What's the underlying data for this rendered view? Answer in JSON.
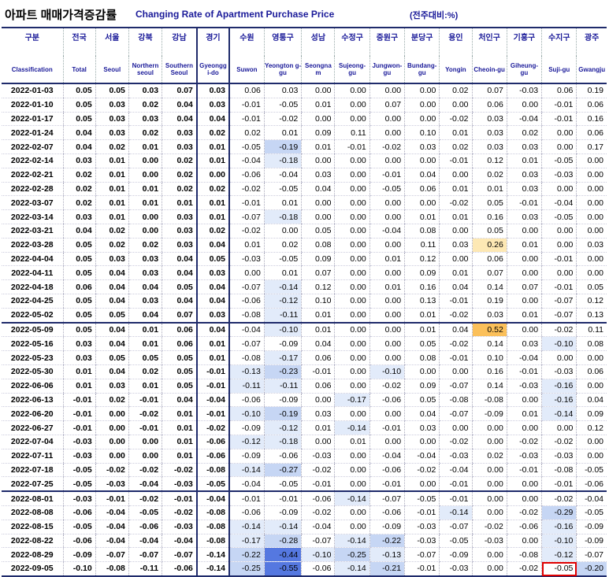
{
  "title": {
    "korean": "아파트 매매가격증감률",
    "english": "Changing Rate of Apartment Purchase Price",
    "unit": "(전주대비:%)"
  },
  "columns": [
    {
      "ko": "구분",
      "en": "Classification"
    },
    {
      "ko": "전국",
      "en": "Total"
    },
    {
      "ko": "서울",
      "en": "Seoul"
    },
    {
      "ko": "강북",
      "en": "Northern seoul"
    },
    {
      "ko": "강남",
      "en": "Southern Seoul"
    },
    {
      "ko": "경기",
      "en": "Gyeongg i-do"
    },
    {
      "ko": "수원",
      "en": "Suwon"
    },
    {
      "ko": "영통구",
      "en": "Yeongton g-gu"
    },
    {
      "ko": "성남",
      "en": "Seongna m"
    },
    {
      "ko": "수정구",
      "en": "Sujeong-gu"
    },
    {
      "ko": "중원구",
      "en": "Jungwon-gu"
    },
    {
      "ko": "분당구",
      "en": "Bundang-gu"
    },
    {
      "ko": "용인",
      "en": "Yongin"
    },
    {
      "ko": "처인구",
      "en": "Cheoin-gu"
    },
    {
      "ko": "기흥구",
      "en": "Giheung-gu"
    },
    {
      "ko": "수지구",
      "en": "Suji-gu"
    },
    {
      "ko": "광주",
      "en": "Gwangju"
    }
  ],
  "rows": [
    {
      "date": "2022-01-03",
      "values": [
        "0.05",
        "0.05",
        "0.03",
        "0.07",
        "0.03",
        "0.06",
        "0.03",
        "0.00",
        "0.00",
        "0.00",
        "0.00",
        "0.02",
        "0.07",
        "-0.03",
        "0.06",
        "0.19"
      ]
    },
    {
      "date": "2022-01-10",
      "values": [
        "0.05",
        "0.03",
        "0.02",
        "0.04",
        "0.03",
        "-0.01",
        "-0.05",
        "0.01",
        "0.00",
        "0.07",
        "0.00",
        "0.00",
        "0.06",
        "0.00",
        "-0.01",
        "0.06"
      ]
    },
    {
      "date": "2022-01-17",
      "values": [
        "0.05",
        "0.03",
        "0.03",
        "0.04",
        "0.04",
        "-0.01",
        "-0.02",
        "0.00",
        "0.00",
        "0.00",
        "0.00",
        "-0.02",
        "0.03",
        "-0.04",
        "-0.01",
        "0.16"
      ]
    },
    {
      "date": "2022-01-24",
      "values": [
        "0.04",
        "0.03",
        "0.02",
        "0.03",
        "0.02",
        "0.02",
        "0.01",
        "0.09",
        "0.11",
        "0.00",
        "0.10",
        "0.01",
        "0.03",
        "0.02",
        "0.00",
        "0.06"
      ]
    },
    {
      "date": "2022-02-07",
      "values": [
        "0.04",
        "0.02",
        "0.01",
        "0.03",
        "0.01",
        "-0.05",
        "-0.19",
        "0.01",
        "-0.01",
        "-0.02",
        "0.03",
        "0.02",
        "0.03",
        "0.03",
        "0.00",
        "0.17"
      ]
    },
    {
      "date": "2022-02-14",
      "values": [
        "0.03",
        "0.01",
        "0.00",
        "0.02",
        "0.01",
        "-0.04",
        "-0.18",
        "0.00",
        "0.00",
        "0.00",
        "0.00",
        "-0.01",
        "0.12",
        "0.01",
        "-0.05",
        "0.00"
      ]
    },
    {
      "date": "2022-02-21",
      "values": [
        "0.02",
        "0.01",
        "0.00",
        "0.02",
        "0.00",
        "-0.06",
        "-0.04",
        "0.03",
        "0.00",
        "-0.01",
        "0.04",
        "0.00",
        "0.02",
        "0.03",
        "-0.03",
        "0.00"
      ]
    },
    {
      "date": "2022-02-28",
      "values": [
        "0.02",
        "0.01",
        "0.01",
        "0.02",
        "0.02",
        "-0.02",
        "-0.05",
        "0.04",
        "0.00",
        "-0.05",
        "0.06",
        "0.01",
        "0.01",
        "0.03",
        "0.00",
        "0.00"
      ]
    },
    {
      "date": "2022-03-07",
      "values": [
        "0.02",
        "0.01",
        "0.01",
        "0.01",
        "0.01",
        "-0.01",
        "0.01",
        "0.00",
        "0.00",
        "0.00",
        "0.00",
        "-0.02",
        "0.05",
        "-0.01",
        "-0.04",
        "0.00"
      ]
    },
    {
      "date": "2022-03-14",
      "values": [
        "0.03",
        "0.01",
        "0.00",
        "0.03",
        "0.01",
        "-0.07",
        "-0.18",
        "0.00",
        "0.00",
        "0.00",
        "0.01",
        "0.01",
        "0.16",
        "0.03",
        "-0.05",
        "0.00"
      ]
    },
    {
      "date": "2022-03-21",
      "values": [
        "0.04",
        "0.02",
        "0.00",
        "0.03",
        "0.02",
        "-0.02",
        "0.00",
        "0.05",
        "0.00",
        "-0.04",
        "0.08",
        "0.00",
        "0.05",
        "0.00",
        "0.00",
        "0.00"
      ]
    },
    {
      "date": "2022-03-28",
      "values": [
        "0.05",
        "0.02",
        "0.02",
        "0.03",
        "0.04",
        "0.01",
        "0.02",
        "0.08",
        "0.00",
        "0.00",
        "0.11",
        "0.03",
        "0.26",
        "0.01",
        "0.00",
        "0.03"
      ]
    },
    {
      "date": "2022-04-04",
      "values": [
        "0.05",
        "0.03",
        "0.03",
        "0.04",
        "0.05",
        "-0.03",
        "-0.05",
        "0.09",
        "0.00",
        "0.01",
        "0.12",
        "0.00",
        "0.06",
        "0.00",
        "-0.01",
        "0.00"
      ]
    },
    {
      "date": "2022-04-11",
      "values": [
        "0.05",
        "0.04",
        "0.03",
        "0.04",
        "0.03",
        "0.00",
        "0.01",
        "0.07",
        "0.00",
        "0.00",
        "0.09",
        "0.01",
        "0.07",
        "0.00",
        "0.00",
        "0.00"
      ]
    },
    {
      "date": "2022-04-18",
      "values": [
        "0.06",
        "0.04",
        "0.04",
        "0.05",
        "0.04",
        "-0.07",
        "-0.14",
        "0.12",
        "0.00",
        "0.01",
        "0.16",
        "0.04",
        "0.14",
        "0.07",
        "-0.01",
        "0.05"
      ]
    },
    {
      "date": "2022-04-25",
      "values": [
        "0.05",
        "0.04",
        "0.03",
        "0.04",
        "0.04",
        "-0.06",
        "-0.12",
        "0.10",
        "0.00",
        "0.00",
        "0.13",
        "-0.01",
        "0.19",
        "0.00",
        "-0.07",
        "0.12"
      ]
    },
    {
      "date": "2022-05-02",
      "values": [
        "0.05",
        "0.05",
        "0.04",
        "0.07",
        "0.03",
        "-0.08",
        "-0.11",
        "0.01",
        "0.00",
        "0.00",
        "0.01",
        "-0.02",
        "0.03",
        "0.01",
        "-0.07",
        "0.13"
      ]
    },
    {
      "date": "2022-05-09",
      "values": [
        "0.05",
        "0.04",
        "0.01",
        "0.06",
        "0.04",
        "-0.04",
        "-0.10",
        "0.01",
        "0.00",
        "0.00",
        "0.01",
        "0.04",
        "0.52",
        "0.00",
        "-0.02",
        "0.11"
      ]
    },
    {
      "date": "2022-05-16",
      "values": [
        "0.03",
        "0.04",
        "0.01",
        "0.06",
        "0.01",
        "-0.07",
        "-0.09",
        "0.04",
        "0.00",
        "0.00",
        "0.05",
        "-0.02",
        "0.14",
        "0.03",
        "-0.10",
        "0.08"
      ]
    },
    {
      "date": "2022-05-23",
      "values": [
        "0.03",
        "0.05",
        "0.05",
        "0.05",
        "0.01",
        "-0.08",
        "-0.17",
        "0.06",
        "0.00",
        "0.00",
        "0.08",
        "-0.01",
        "0.10",
        "-0.04",
        "0.00",
        "0.00"
      ]
    },
    {
      "date": "2022-05-30",
      "values": [
        "0.01",
        "0.04",
        "0.02",
        "0.05",
        "-0.01",
        "-0.13",
        "-0.23",
        "-0.01",
        "0.00",
        "-0.10",
        "0.00",
        "0.00",
        "0.16",
        "-0.01",
        "-0.03",
        "0.06"
      ]
    },
    {
      "date": "2022-06-06",
      "values": [
        "0.01",
        "0.03",
        "0.01",
        "0.05",
        "-0.01",
        "-0.11",
        "-0.11",
        "0.06",
        "0.00",
        "-0.02",
        "0.09",
        "-0.07",
        "0.14",
        "-0.03",
        "-0.16",
        "0.00"
      ]
    },
    {
      "date": "2022-06-13",
      "values": [
        "-0.01",
        "0.02",
        "-0.01",
        "0.04",
        "-0.04",
        "-0.06",
        "-0.09",
        "0.00",
        "-0.17",
        "-0.06",
        "0.05",
        "-0.08",
        "-0.08",
        "0.00",
        "-0.16",
        "0.04"
      ]
    },
    {
      "date": "2022-06-20",
      "values": [
        "-0.01",
        "0.00",
        "-0.02",
        "0.01",
        "-0.01",
        "-0.10",
        "-0.19",
        "0.03",
        "0.00",
        "0.00",
        "0.04",
        "-0.07",
        "-0.09",
        "0.01",
        "-0.14",
        "0.09"
      ]
    },
    {
      "date": "2022-06-27",
      "values": [
        "-0.01",
        "0.00",
        "-0.01",
        "0.01",
        "-0.02",
        "-0.09",
        "-0.12",
        "0.01",
        "-0.14",
        "-0.01",
        "0.03",
        "0.00",
        "0.00",
        "0.00",
        "0.00",
        "0.12"
      ]
    },
    {
      "date": "2022-07-04",
      "values": [
        "-0.03",
        "0.00",
        "0.00",
        "0.01",
        "-0.06",
        "-0.12",
        "-0.18",
        "0.00",
        "0.01",
        "0.00",
        "0.00",
        "-0.02",
        "0.00",
        "-0.02",
        "-0.02",
        "0.00"
      ]
    },
    {
      "date": "2022-07-11",
      "values": [
        "-0.03",
        "0.00",
        "0.00",
        "0.01",
        "-0.06",
        "-0.09",
        "-0.06",
        "-0.03",
        "0.00",
        "-0.04",
        "-0.04",
        "-0.03",
        "0.02",
        "-0.03",
        "-0.03",
        "0.00"
      ]
    },
    {
      "date": "2022-07-18",
      "values": [
        "-0.05",
        "-0.02",
        "-0.02",
        "-0.02",
        "-0.08",
        "-0.14",
        "-0.27",
        "-0.02",
        "0.00",
        "-0.06",
        "-0.02",
        "-0.04",
        "0.00",
        "-0.01",
        "-0.08",
        "-0.05"
      ]
    },
    {
      "date": "2022-07-25",
      "values": [
        "-0.05",
        "-0.03",
        "-0.04",
        "-0.03",
        "-0.05",
        "-0.04",
        "-0.05",
        "-0.01",
        "0.00",
        "-0.01",
        "0.00",
        "-0.01",
        "0.00",
        "0.00",
        "-0.01",
        "-0.06"
      ]
    },
    {
      "date": "2022-08-01",
      "values": [
        "-0.03",
        "-0.01",
        "-0.02",
        "-0.01",
        "-0.04",
        "-0.01",
        "-0.01",
        "-0.06",
        "-0.14",
        "-0.07",
        "-0.05",
        "-0.01",
        "0.00",
        "0.00",
        "-0.02",
        "-0.04"
      ]
    },
    {
      "date": "2022-08-08",
      "values": [
        "-0.06",
        "-0.04",
        "-0.05",
        "-0.02",
        "-0.08",
        "-0.06",
        "-0.09",
        "-0.02",
        "0.00",
        "-0.06",
        "-0.01",
        "-0.14",
        "0.00",
        "-0.02",
        "-0.29",
        "-0.05"
      ]
    },
    {
      "date": "2022-08-15",
      "values": [
        "-0.05",
        "-0.04",
        "-0.06",
        "-0.03",
        "-0.08",
        "-0.14",
        "-0.14",
        "-0.04",
        "0.00",
        "-0.09",
        "-0.03",
        "-0.07",
        "-0.02",
        "-0.06",
        "-0.16",
        "-0.09"
      ]
    },
    {
      "date": "2022-08-22",
      "values": [
        "-0.06",
        "-0.04",
        "-0.04",
        "-0.04",
        "-0.08",
        "-0.17",
        "-0.28",
        "-0.07",
        "-0.14",
        "-0.22",
        "-0.03",
        "-0.05",
        "-0.03",
        "0.00",
        "-0.10",
        "-0.09"
      ]
    },
    {
      "date": "2022-08-29",
      "values": [
        "-0.09",
        "-0.07",
        "-0.07",
        "-0.07",
        "-0.14",
        "-0.22",
        "-0.44",
        "-0.10",
        "-0.25",
        "-0.13",
        "-0.07",
        "-0.09",
        "0.00",
        "-0.08",
        "-0.12",
        "-0.07"
      ]
    },
    {
      "date": "2022-09-05",
      "values": [
        "-0.10",
        "-0.08",
        "-0.11",
        "-0.06",
        "-0.14",
        "-0.25",
        "-0.55",
        "-0.06",
        "-0.14",
        "-0.21",
        "-0.01",
        "-0.03",
        "0.00",
        "-0.02",
        "-0.05",
        "-0.20"
      ]
    }
  ],
  "colors": {
    "header_text": "#1a1a99",
    "rule": "#1f2b6b",
    "neg_light": "#e2ebfa",
    "neg_mid": "#c6d6f4",
    "neg_strong": "#5578e0",
    "pos_light": "#fde8b4",
    "pos_strong": "#fbc05a",
    "highlight_box": "#e00000"
  }
}
